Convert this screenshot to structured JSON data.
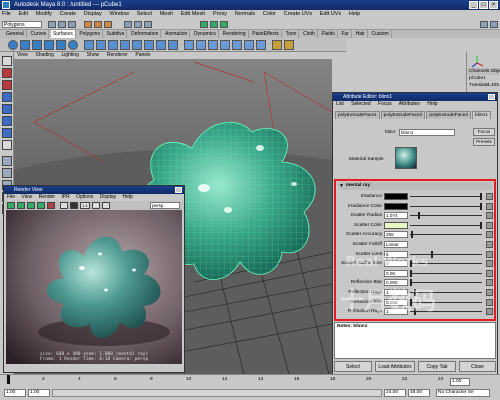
{
  "window": {
    "title": "Autodesk Maya 8.0 : /untitled  ---  pCube1"
  },
  "menubar": [
    "File",
    "Edit",
    "Modify",
    "Create",
    "Display",
    "Window",
    "Select",
    "Mesh",
    "Edit Mesh",
    "Proxy",
    "Normals",
    "Color",
    "Create UVs",
    "Edit UVs",
    "Help"
  ],
  "status": {
    "mode": "Polygons"
  },
  "shelf_tabs": [
    "General",
    "Curves",
    "Surfaces",
    "Polygons",
    "Subdivs",
    "Deformation",
    "Animation",
    "Dynamics",
    "Rendering",
    "PaintEffects",
    "Toon",
    "Cloth",
    "Fluids",
    "Fur",
    "Hair",
    "Custom"
  ],
  "shelf_active": 2,
  "viewport": {
    "menu": [
      "View",
      "Shading",
      "Lighting",
      "Show",
      "Renderer",
      "Panels"
    ]
  },
  "render_view": {
    "title": "Render View",
    "menu": [
      "File",
      "View",
      "Render",
      "IPR",
      "Options",
      "Display",
      "Help"
    ],
    "camera_field": "persp",
    "info_line1": "size: 640 x 480  zoom: 1.000        (mental ray)",
    "info_line2": "Frame: 1      Render Time: 0:18        Camera: persp"
  },
  "channels": {
    "header": "Channels  Object",
    "object": "pCube1",
    "attr": "Translate",
    "value": "1.405"
  },
  "attribute_editor": {
    "title": "Attribute Editor: blinn1",
    "menu": [
      "List",
      "Selected",
      "Focus",
      "Attributes",
      "Help"
    ],
    "tabs": [
      "polyExtrudeFace1",
      "polyExtrudeFace2",
      "polyExtrudeFace3",
      "blinn1"
    ],
    "active_tab": 3,
    "blinn_label": "blinn:",
    "blinn_value": "blinn1",
    "focus_btn": "Focus",
    "presets_btn": "Presets",
    "material_sample": "Material Sample",
    "section": "mental ray",
    "rows": [
      {
        "label": "Irradiance",
        "type": "color",
        "color": "#000000"
      },
      {
        "label": "Irradiance Color",
        "type": "color",
        "color": "#000000"
      },
      {
        "label": "Scatter Radius",
        "value": "1.074",
        "frac": 0.12
      },
      {
        "label": "Scatter Color",
        "type": "color",
        "color": "#eaf8c6"
      },
      {
        "label": "Scatter Accuracy",
        "value": "256",
        "frac": 0.02
      },
      {
        "label": "Scatter Falloff",
        "value": "Linear",
        "type": "select"
      },
      {
        "label": "Scatter Limit",
        "value": "5",
        "frac": 0.3
      },
      {
        "label": "Scatter Cache Size",
        "value": "0",
        "frac": 0.0
      },
      {
        "label": "",
        "value": "0.00",
        "frac": 0.0
      },
      {
        "label": "Reflection Blur",
        "value": "0.000",
        "frac": 0.0
      },
      {
        "label": "Reflection Rays",
        "value": "1",
        "frac": 0.05
      },
      {
        "label": "Refraction Blur",
        "value": "0.000",
        "frac": 0.0
      },
      {
        "label": "Refraction Rays",
        "value": "1",
        "frac": 0.05
      }
    ],
    "notes_label": "Notes: blinn1",
    "buttons": [
      "Select",
      "Load Attributes",
      "Copy Tab",
      "Close"
    ]
  },
  "timeline": {
    "ticks": [
      "1",
      "2",
      "4",
      "6",
      "8",
      "10",
      "12",
      "14",
      "16",
      "18",
      "20",
      "22",
      "24"
    ],
    "start": "1.00",
    "end": "24.00",
    "range_start": "1.00",
    "range_end": "48.00",
    "current": "1.00",
    "character_set": "No Character Se"
  },
  "watermarks": [
    "Real Works",
    "十月数码"
  ]
}
